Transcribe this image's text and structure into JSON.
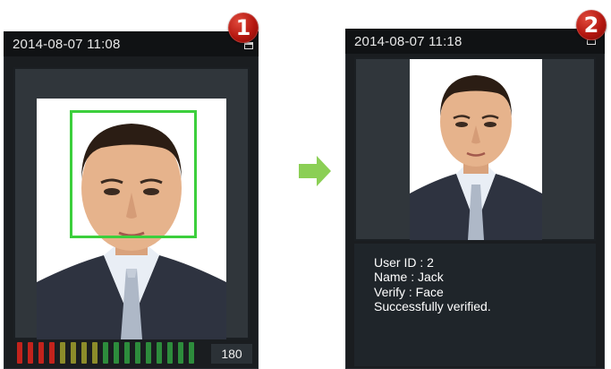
{
  "steps": [
    {
      "badge": "1",
      "datetime": "2014-08-07 11:08",
      "score": "180",
      "level_segments": [
        {
          "color": "#c3231c"
        },
        {
          "color": "#c3231c"
        },
        {
          "color": "#c3231c"
        },
        {
          "color": "#c3231c"
        },
        {
          "color": "#8c8c2a"
        },
        {
          "color": "#8c8c2a"
        },
        {
          "color": "#8c8c2a"
        },
        {
          "color": "#8c8c2a"
        },
        {
          "color": "#2d8c3c"
        },
        {
          "color": "#2d8c3c"
        },
        {
          "color": "#2d8c3c"
        },
        {
          "color": "#2d8c3c"
        },
        {
          "color": "#2d8c3c"
        },
        {
          "color": "#2d8c3c"
        },
        {
          "color": "#2d8c3c"
        },
        {
          "color": "#2d8c3c"
        },
        {
          "color": "#2d8c3c"
        }
      ]
    },
    {
      "badge": "2",
      "datetime": "2014-08-07 11:18",
      "info": {
        "user_id": "User ID : 2",
        "name": "Name : Jack",
        "verify": "Verify : Face",
        "status": "Successfully verified."
      }
    }
  ],
  "colors": {
    "face_box": "#3ccf3c",
    "arrow": "#8bcf55",
    "badge": "#b3160f"
  }
}
